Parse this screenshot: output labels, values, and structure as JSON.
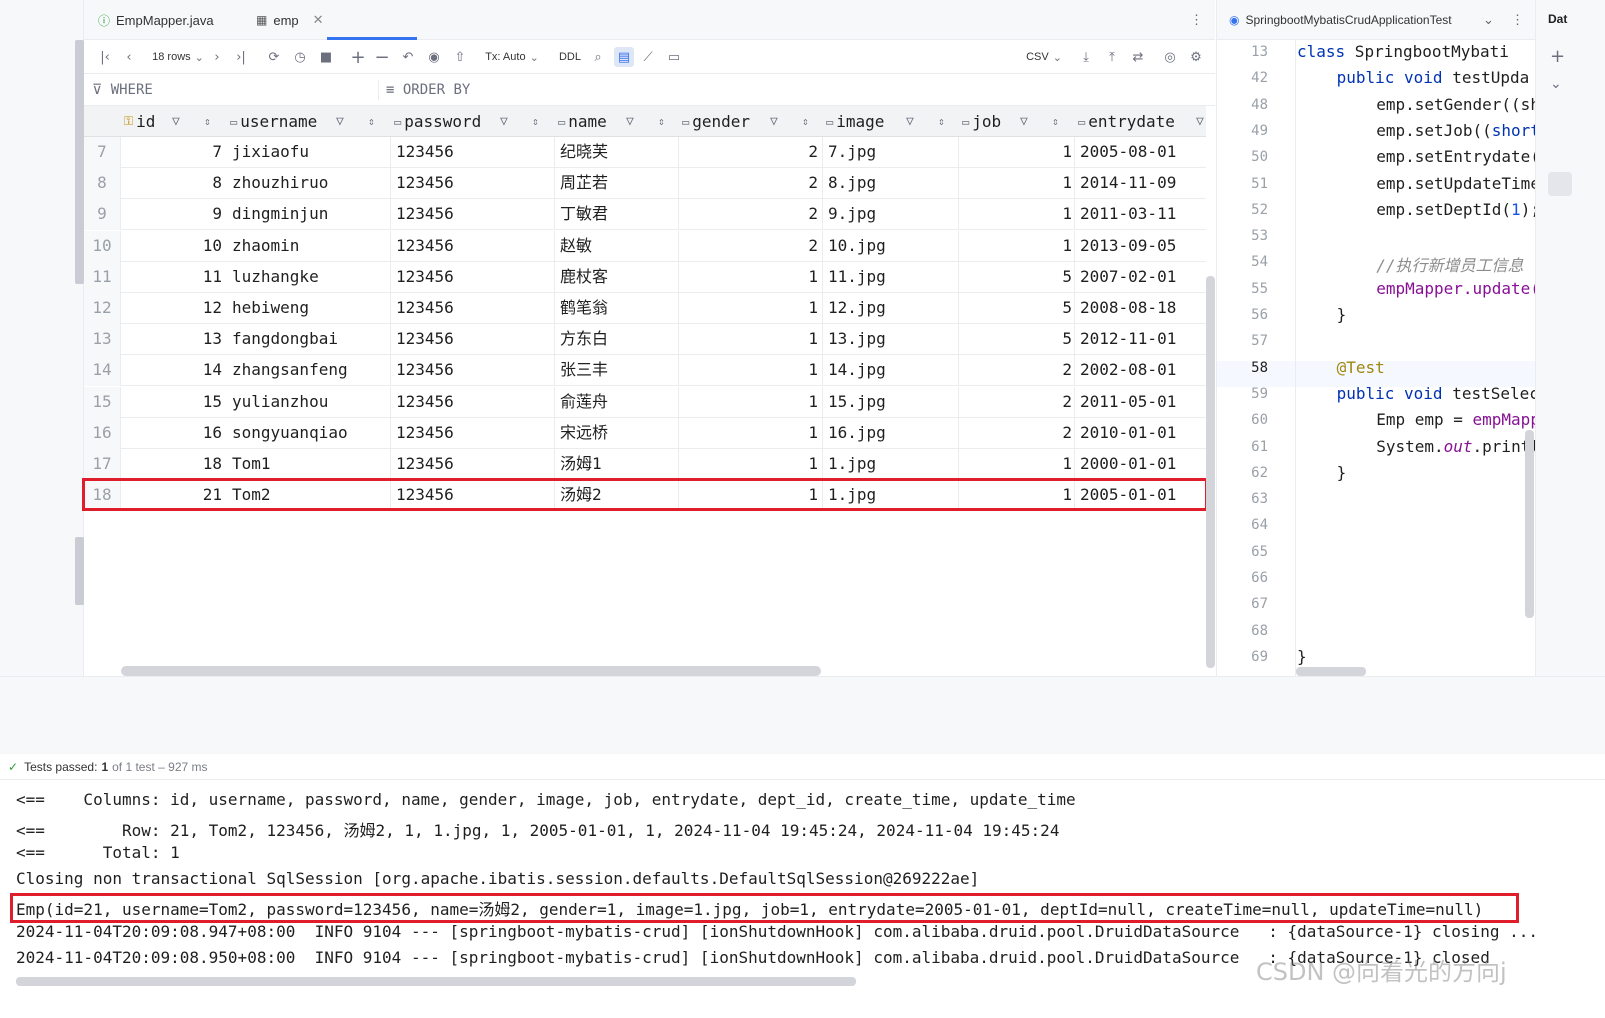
{
  "editor_tabs": [
    {
      "label": "EmpMapper.java",
      "icon": "interface-icon",
      "active": false
    },
    {
      "label": "emp",
      "icon": "table-icon",
      "active": true,
      "closable": true
    }
  ],
  "code_tab": {
    "label": "SpringbootMybatisCrudApplicationTest",
    "side_label": "Dat"
  },
  "toolbar": {
    "rows_label": "18 rows",
    "tx_label": "Tx: Auto",
    "ddl_label": "DDL",
    "export_format": "CSV"
  },
  "filters": {
    "where_label": "WHERE",
    "order_by_label": "ORDER BY"
  },
  "grid": {
    "columns": [
      "id",
      "username",
      "password",
      "name",
      "gender",
      "image",
      "job",
      "entrydate"
    ],
    "rows": [
      {
        "rn": "7",
        "id": "7",
        "username": "jixiaofu",
        "password": "123456",
        "name": "纪晓芙",
        "gender": "2",
        "image": "7.jpg",
        "job": "1",
        "entrydate": "2005-08-01"
      },
      {
        "rn": "8",
        "id": "8",
        "username": "zhouzhiruo",
        "password": "123456",
        "name": "周芷若",
        "gender": "2",
        "image": "8.jpg",
        "job": "1",
        "entrydate": "2014-11-09"
      },
      {
        "rn": "9",
        "id": "9",
        "username": "dingminjun",
        "password": "123456",
        "name": "丁敏君",
        "gender": "2",
        "image": "9.jpg",
        "job": "1",
        "entrydate": "2011-03-11"
      },
      {
        "rn": "10",
        "id": "10",
        "username": "zhaomin",
        "password": "123456",
        "name": "赵敏",
        "gender": "2",
        "image": "10.jpg",
        "job": "1",
        "entrydate": "2013-09-05"
      },
      {
        "rn": "11",
        "id": "11",
        "username": "luzhangke",
        "password": "123456",
        "name": "鹿杖客",
        "gender": "1",
        "image": "11.jpg",
        "job": "5",
        "entrydate": "2007-02-01"
      },
      {
        "rn": "12",
        "id": "12",
        "username": "hebiweng",
        "password": "123456",
        "name": "鹤笔翁",
        "gender": "1",
        "image": "12.jpg",
        "job": "5",
        "entrydate": "2008-08-18"
      },
      {
        "rn": "13",
        "id": "13",
        "username": "fangdongbai",
        "password": "123456",
        "name": "方东白",
        "gender": "1",
        "image": "13.jpg",
        "job": "5",
        "entrydate": "2012-11-01"
      },
      {
        "rn": "14",
        "id": "14",
        "username": "zhangsanfeng",
        "password": "123456",
        "name": "张三丰",
        "gender": "1",
        "image": "14.jpg",
        "job": "2",
        "entrydate": "2002-08-01"
      },
      {
        "rn": "15",
        "id": "15",
        "username": "yulianzhou",
        "password": "123456",
        "name": "俞莲舟",
        "gender": "1",
        "image": "15.jpg",
        "job": "2",
        "entrydate": "2011-05-01"
      },
      {
        "rn": "16",
        "id": "16",
        "username": "songyuanqiao",
        "password": "123456",
        "name": "宋远桥",
        "gender": "1",
        "image": "16.jpg",
        "job": "2",
        "entrydate": "2010-01-01"
      },
      {
        "rn": "17",
        "id": "18",
        "username": "Tom1",
        "password": "123456",
        "name": "汤姆1",
        "gender": "1",
        "image": "1.jpg",
        "job": "1",
        "entrydate": "2000-01-01"
      },
      {
        "rn": "18",
        "id": "21",
        "username": "Tom2",
        "password": "123456",
        "name": "汤姆2",
        "gender": "1",
        "image": "1.jpg",
        "job": "1",
        "entrydate": "2005-01-01"
      }
    ]
  },
  "code": {
    "lines": [
      {
        "n": "13",
        "text": "class SpringbootMybati"
      },
      {
        "n": "42",
        "text": "public void testUpda"
      },
      {
        "n": "48",
        "text": "emp.setGender((sh"
      },
      {
        "n": "49",
        "text": "emp.setJob((short"
      },
      {
        "n": "50",
        "text": "emp.setEntrydate("
      },
      {
        "n": "51",
        "text": "emp.setUpdateTime"
      },
      {
        "n": "52",
        "text": "emp.setDeptId(1);"
      },
      {
        "n": "53",
        "text": ""
      },
      {
        "n": "54",
        "text": "//执行新增员工信息"
      },
      {
        "n": "55",
        "text": "empMapper.update("
      },
      {
        "n": "56",
        "text": "}"
      },
      {
        "n": "57",
        "text": ""
      },
      {
        "n": "58",
        "text": "@Test"
      },
      {
        "n": "59",
        "text": "public void testSelec"
      },
      {
        "n": "60",
        "text": "Emp emp = empMapp"
      },
      {
        "n": "61",
        "text": "System.out.printl"
      },
      {
        "n": "62",
        "text": "}"
      },
      {
        "n": "63",
        "text": ""
      },
      {
        "n": "64",
        "text": ""
      },
      {
        "n": "65",
        "text": ""
      },
      {
        "n": "66",
        "text": ""
      },
      {
        "n": "67",
        "text": ""
      },
      {
        "n": "68",
        "text": ""
      },
      {
        "n": "69",
        "text": "}"
      }
    ]
  },
  "test_status": {
    "label": "Tests passed:",
    "count": "1",
    "suffix": "of 1 test – 927 ms"
  },
  "console": [
    "<==    Columns: id, username, password, name, gender, image, job, entrydate, dept_id, create_time, update_time",
    "<==        Row: 21, Tom2, 123456, 汤姆2, 1, 1.jpg, 1, 2005-01-01, 1, 2024-11-04 19:45:24, 2024-11-04 19:45:24",
    "<==      Total: 1",
    "Closing non transactional SqlSession [org.apache.ibatis.session.defaults.DefaultSqlSession@269222ae]",
    "Emp(id=21, username=Tom2, password=123456, name=汤姆2, gender=1, image=1.jpg, job=1, entrydate=2005-01-01, deptId=null, createTime=null, updateTime=null)",
    "2024-11-04T20:09:08.947+08:00  INFO 9104 --- [springboot-mybatis-crud] [ionShutdownHook] com.alibaba.druid.pool.DruidDataSource   : {dataSource-1} closing ...",
    "2024-11-04T20:09:08.950+08:00  INFO 9104 --- [springboot-mybatis-crud] [ionShutdownHook] com.alibaba.druid.pool.DruidDataSource   : {dataSource-1} closed"
  ],
  "watermark": "CSDN @向着光的方向j",
  "colors": {
    "highlight": "#e01e2b",
    "accent": "#3574f0",
    "keyword": "#0033b3",
    "annotation": "#9e880d"
  }
}
